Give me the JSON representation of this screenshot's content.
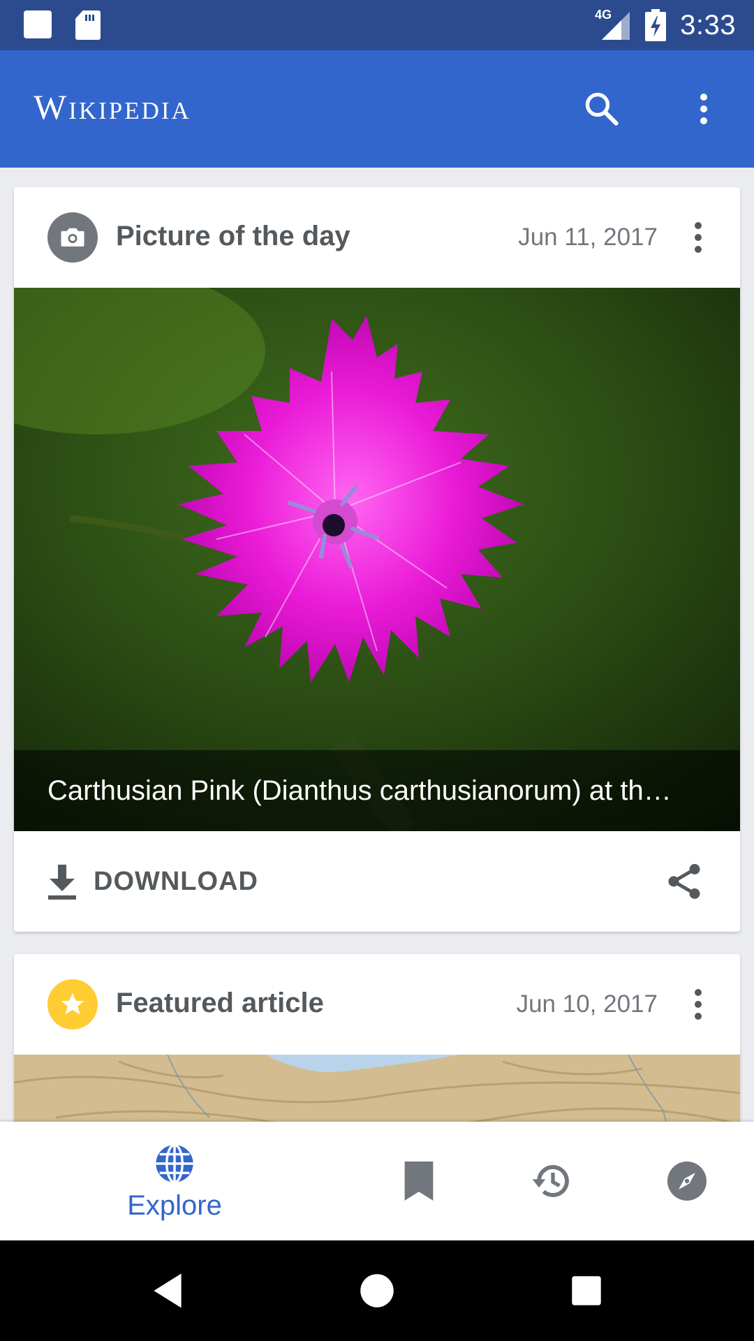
{
  "status_bar": {
    "network": "4G",
    "time": "3:33"
  },
  "app_bar": {
    "title": "Wikipedia",
    "icons": [
      "search-icon",
      "overflow-menu-icon"
    ]
  },
  "cards": [
    {
      "title": "Picture of the day",
      "date": "Jun 11, 2017",
      "icon": "camera-icon",
      "caption": "Carthusian Pink (Dianthus carthusianorum) at th…",
      "download_label": "DOWNLOAD",
      "share_icon": "share-icon"
    },
    {
      "title": "Featured article",
      "date": "Jun 10, 2017",
      "icon": "star-icon",
      "icon_color": "#ffcc33"
    }
  ],
  "bottom_nav": {
    "items": [
      {
        "label": "Explore",
        "icon": "globe-icon",
        "selected": true
      },
      {
        "label": "",
        "icon": "bookmark-icon",
        "selected": false
      },
      {
        "label": "",
        "icon": "history-icon",
        "selected": false
      },
      {
        "label": "",
        "icon": "compass-icon",
        "selected": false
      }
    ]
  },
  "colors": {
    "status_bar": "#2c4b8f",
    "app_bar": "#3366cc",
    "accent": "#3366cc",
    "background": "#eaecf0"
  }
}
